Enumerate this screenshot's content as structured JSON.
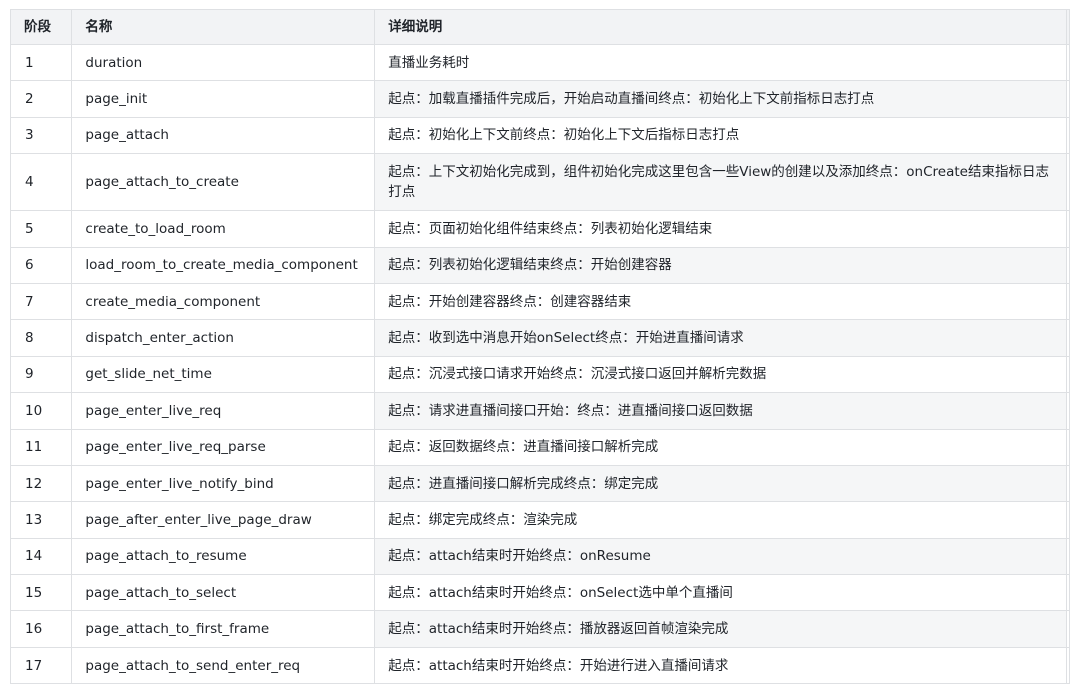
{
  "table": {
    "headers": [
      "阶段",
      "名称",
      "详细说明",
      ""
    ],
    "rows": [
      {
        "stage": "1",
        "name": "duration",
        "desc": "直播业务耗时"
      },
      {
        "stage": "2",
        "name": "page_init",
        "desc": "起点：加载直播插件完成后，开始启动直播间终点：初始化上下文前指标日志打点"
      },
      {
        "stage": "3",
        "name": "page_attach",
        "desc": "起点：初始化上下文前终点：初始化上下文后指标日志打点"
      },
      {
        "stage": "4",
        "name": "page_attach_to_create",
        "desc": "起点：上下文初始化完成到，组件初始化完成这里包含一些View的创建以及添加终点：onCreate结束指标日志打点"
      },
      {
        "stage": "5",
        "name": "create_to_load_room",
        "desc": "起点：页面初始化组件结束终点：列表初始化逻辑结束"
      },
      {
        "stage": "6",
        "name": "load_room_to_create_media_component",
        "desc": "起点：列表初始化逻辑结束终点：开始创建容器"
      },
      {
        "stage": "7",
        "name": "create_media_component",
        "desc": "起点：开始创建容器终点：创建容器结束"
      },
      {
        "stage": "8",
        "name": "dispatch_enter_action",
        "desc": "起点：收到选中消息开始onSelect终点：开始进直播间请求"
      },
      {
        "stage": "9",
        "name": "get_slide_net_time",
        "desc": "起点：沉浸式接口请求开始终点：沉浸式接口返回并解析完数据"
      },
      {
        "stage": "10",
        "name": "page_enter_live_req",
        "desc": "起点：请求进直播间接口开始：终点：进直播间接口返回数据"
      },
      {
        "stage": "11",
        "name": "page_enter_live_req_parse",
        "desc": "起点：返回数据终点：进直播间接口解析完成"
      },
      {
        "stage": "12",
        "name": "page_enter_live_notify_bind",
        "desc": "起点：进直播间接口解析完成终点：绑定完成"
      },
      {
        "stage": "13",
        "name": "page_after_enter_live_page_draw",
        "desc": "起点：绑定完成终点：渲染完成"
      },
      {
        "stage": "14",
        "name": "page_attach_to_resume",
        "desc": "起点：attach结束时开始终点：onResume"
      },
      {
        "stage": "15",
        "name": "page_attach_to_select",
        "desc": "起点：attach结束时开始终点：onSelect选中单个直播间"
      },
      {
        "stage": "16",
        "name": "page_attach_to_first_frame",
        "desc": "起点：attach结束时开始终点：播放器返回首帧渲染完成"
      },
      {
        "stage": "17",
        "name": "page_attach_to_send_enter_req",
        "desc": "起点：attach结束时开始终点：开始进行进入直播间请求"
      }
    ]
  }
}
